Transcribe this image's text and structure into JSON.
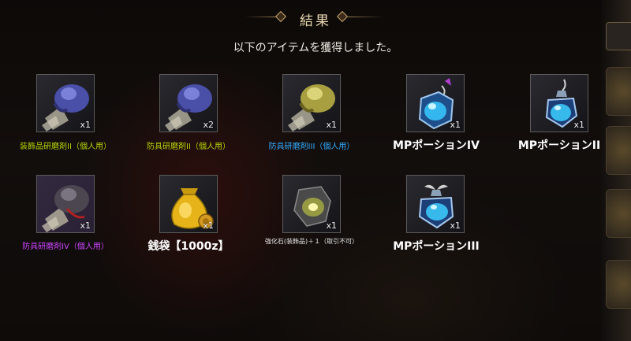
{
  "title": "結果",
  "subtitle": "以下のアイテムを獲得しました。",
  "colors": {
    "green_name": "#b8d400",
    "blue_name": "#33aaff",
    "purple_name": "#cc44ff",
    "white_name": "#ffffff"
  },
  "items": [
    {
      "name": "装飾品研磨剤II（個人用）",
      "qty": "x1",
      "icon": "polish-bag-blue-icon",
      "rarity": "green"
    },
    {
      "name": "防具研磨剤II（個人用）",
      "qty": "x2",
      "icon": "polish-bag-blue-icon",
      "rarity": "green"
    },
    {
      "name": "防具研磨剤III（個人用）",
      "qty": "x1",
      "icon": "polish-bag-gold-icon",
      "rarity": "blue"
    },
    {
      "name": "MPポーションIV",
      "qty": "x1",
      "icon": "mp-potion-icon",
      "rarity": "white"
    },
    {
      "name": "MPポーションII",
      "qty": "x1",
      "icon": "mp-potion-icon",
      "rarity": "white"
    },
    {
      "name": "防具研磨剤IV（個人用）",
      "qty": "x1",
      "icon": "polish-bag-dark-icon",
      "rarity": "purple"
    },
    {
      "name": "銭袋【1000z】",
      "qty": "x1",
      "icon": "money-bag-icon",
      "rarity": "white"
    },
    {
      "name": "強化石(装飾品)＋１（取引不可）",
      "qty": "x1",
      "icon": "enhancement-stone-icon",
      "rarity": "white"
    },
    {
      "name": "MPポーションIII",
      "qty": "x1",
      "icon": "mp-potion-winged-icon",
      "rarity": "white"
    }
  ]
}
